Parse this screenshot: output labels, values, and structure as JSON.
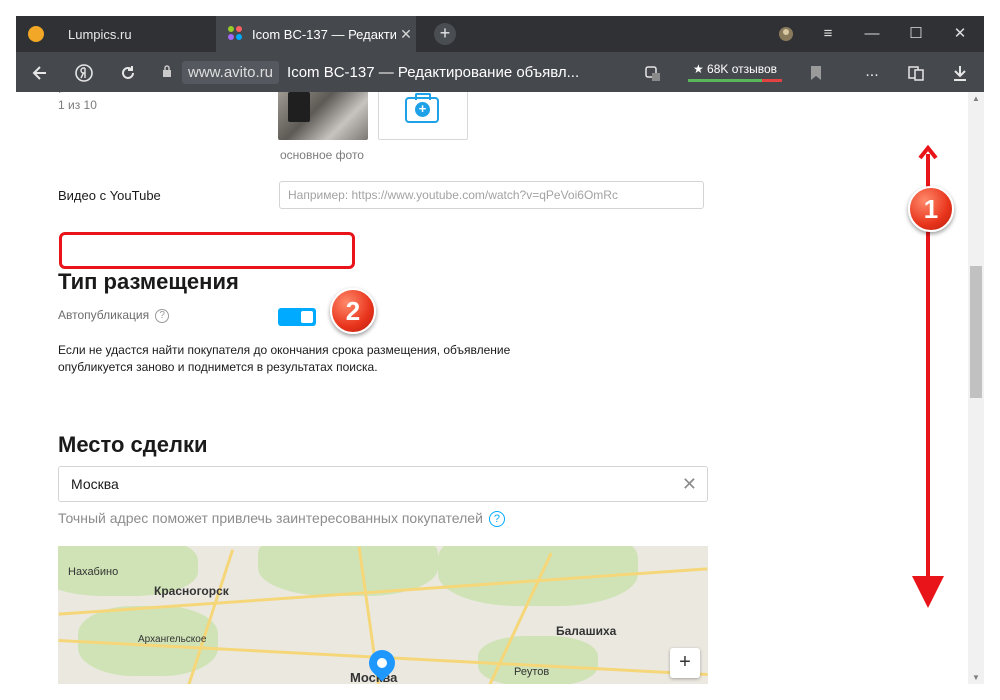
{
  "browser": {
    "tabs": [
      {
        "label": "Lumpics.ru",
        "active": false
      },
      {
        "label": "Icom BC-137 — Редакти",
        "active": true
      }
    ],
    "tab_close": "✕",
    "new_tab": "+",
    "window_controls": {
      "menu": "≡",
      "minimize": "—",
      "maximize": "☐",
      "close": "✕"
    },
    "address": {
      "domain": "www.avito.ru",
      "title": "Icom BC-137 — Редактирование объявл..."
    },
    "reviews_badge": "★ 68K отзывов",
    "toolbar_more": "..."
  },
  "page": {
    "photos_counter": "1 из 10",
    "main_photo_label": "основное фото",
    "video_label": "Видео с YouTube",
    "video_placeholder": "Например: https://www.youtube.com/watch?v=qPeVoi6OmRc",
    "placement_heading": "Тип размещения",
    "autopublish_label": "Автопубликация",
    "autopublish_on": true,
    "autopublish_hint": "Если не удастся найти покупателя до окончания срока размещения, объявление опубликуется заново и поднимется в результатах поиска.",
    "deal_heading": "Место сделки",
    "city_value": "Москва",
    "address_hint": "Точный адрес поможет привлечь заинтересованных покупателей",
    "help_glyph": "?",
    "clear_glyph": "✕",
    "map": {
      "labels": [
        "Нахабино",
        "Красногорск",
        "Архангельское",
        "Балашиха",
        "Реутов",
        "Москва"
      ],
      "zoom_in": "+"
    }
  },
  "annotations": {
    "step1": "1",
    "step2": "2"
  },
  "colors": {
    "accent": "#00aaff",
    "annotation": "#e8141a",
    "browser_dark": "#2f3135",
    "browser_toolbar": "#45484d"
  }
}
